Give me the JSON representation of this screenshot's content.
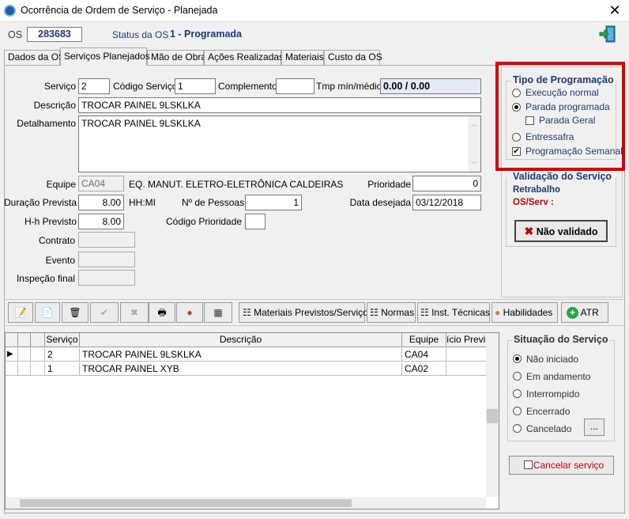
{
  "window": {
    "title": "Ocorrência de Ordem de Serviço - Planejada",
    "close": "✕"
  },
  "header": {
    "os_label": "OS",
    "os_number": "283683",
    "status_label": "Status da OS",
    "status_value": "1 - Programada"
  },
  "tabs": [
    "Dados da OS",
    "Serviços Planejados",
    "Mão de Obra",
    "Ações Realizadas",
    "Materiais",
    "Custo da OS"
  ],
  "form": {
    "servico_label": "Serviço",
    "servico_value": "2",
    "codigo_servico_label": "Código Serviço",
    "codigo_servico_value": "1",
    "complemento_label": "Complemento",
    "complemento_value": "",
    "tmp_label": "Tmp mín/médio",
    "tmp_value": "0.00 / 0.00",
    "descricao_label": "Descrição",
    "descricao_value": "TROCAR PAINEL 9LSKLKA",
    "detalhamento_label": "Detalhamento",
    "detalhamento_value": "TROCAR PAINEL 9LSKLKA",
    "equipe_label": "Equipe",
    "equipe_value": "CA04",
    "equipe_desc": "EQ. MANUT.  ELETRO-ELETRÔNICA CALDEIRAS",
    "prioridade_label": "Prioridade",
    "prioridade_value": "0",
    "duracao_label": "Duração Prevista",
    "duracao_value": "8.00",
    "duracao_unit": "HH:MI",
    "pessoas_label": "Nº de Pessoas",
    "pessoas_value": "1",
    "data_label": "Data desejada",
    "data_value": "03/12/2018",
    "hh_label": "H-h Previsto",
    "hh_value": "8.00",
    "codigo_prioridade_label": "Código Prioridade",
    "codigo_prioridade_value": "",
    "contrato_label": "Contrato",
    "evento_label": "Evento",
    "inspecao_label": "Inspeção final"
  },
  "tipo_programacao": {
    "title": "Tipo de Programação",
    "options": [
      "Execução normal",
      "Parada programada",
      "Parada Geral",
      "Entressafra",
      "Programação Semanal"
    ],
    "selected": "Parada programada",
    "parada_geral_checked": false,
    "programacao_semanal_checked": true
  },
  "validacao": {
    "title": "Validação do Serviço",
    "retrabalho": "Retrabalho",
    "os_serv": "OS/Serv :",
    "button": "Não validado"
  },
  "toolbar": {
    "materiais": "Materiais Previstos/Serviços",
    "normas": "Normas",
    "inst_tecnicas": "Inst. Técnicas",
    "habilidades": "Habilidades",
    "atr": "ATR"
  },
  "grid": {
    "columns": [
      "Serviço",
      "Descrição",
      "Equipe",
      "ício Previs"
    ],
    "rows": [
      {
        "servico": "2",
        "descricao": "TROCAR PAINEL 9LSKLKA",
        "equipe": "CA04"
      },
      {
        "servico": "1",
        "descricao": "TROCAR PAINEL XYB",
        "equipe": "CA02"
      }
    ]
  },
  "situacao": {
    "title": "Situação do Serviço",
    "options": [
      "Não iniciado",
      "Em andamento",
      "Interrompido",
      "Encerrado",
      "Cancelado"
    ],
    "selected": "Não iniciado",
    "ellipsis": "...",
    "cancelar": "Cancelar serviço"
  },
  "colors": {
    "accent_blue": "#1f3a73",
    "highlight_red": "#d90000",
    "error_red": "#c00000"
  }
}
